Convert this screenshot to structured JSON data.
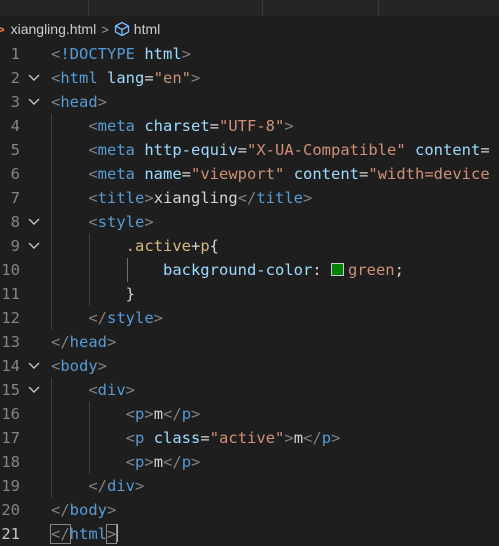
{
  "breadcrumb": {
    "file_name": "xiangling.html",
    "symbol_name": "html"
  },
  "lines": [
    {
      "n": "1",
      "fold": "",
      "tokens": [
        {
          "t": "punc",
          "v": "<"
        },
        {
          "t": "tag",
          "v": "!DOCTYPE"
        },
        {
          "t": "text",
          "v": " "
        },
        {
          "t": "attr",
          "v": "html"
        },
        {
          "t": "punc",
          "v": ">"
        }
      ]
    },
    {
      "n": "2",
      "fold": "⌵",
      "tokens": [
        {
          "t": "punc",
          "v": "<"
        },
        {
          "t": "tag",
          "v": "html"
        },
        {
          "t": "text",
          "v": " "
        },
        {
          "t": "attr",
          "v": "lang"
        },
        {
          "t": "text",
          "v": "="
        },
        {
          "t": "str",
          "v": "\"en\""
        },
        {
          "t": "punc",
          "v": ">"
        }
      ]
    },
    {
      "n": "3",
      "fold": "⌵",
      "tokens": [
        {
          "t": "punc",
          "v": "<"
        },
        {
          "t": "tag",
          "v": "head"
        },
        {
          "t": "punc",
          "v": ">"
        }
      ]
    },
    {
      "n": "4",
      "fold": "",
      "tokens": [
        {
          "t": "text",
          "v": "    "
        },
        {
          "t": "punc",
          "v": "<"
        },
        {
          "t": "tag",
          "v": "meta"
        },
        {
          "t": "text",
          "v": " "
        },
        {
          "t": "attr",
          "v": "charset"
        },
        {
          "t": "text",
          "v": "="
        },
        {
          "t": "str",
          "v": "\"UTF-8\""
        },
        {
          "t": "punc",
          "v": ">"
        }
      ]
    },
    {
      "n": "5",
      "fold": "",
      "tokens": [
        {
          "t": "text",
          "v": "    "
        },
        {
          "t": "punc",
          "v": "<"
        },
        {
          "t": "tag",
          "v": "meta"
        },
        {
          "t": "text",
          "v": " "
        },
        {
          "t": "attr",
          "v": "http-equiv"
        },
        {
          "t": "text",
          "v": "="
        },
        {
          "t": "str",
          "v": "\"X-UA-Compatible\""
        },
        {
          "t": "text",
          "v": " "
        },
        {
          "t": "attr",
          "v": "content"
        },
        {
          "t": "text",
          "v": "="
        }
      ]
    },
    {
      "n": "6",
      "fold": "",
      "tokens": [
        {
          "t": "text",
          "v": "    "
        },
        {
          "t": "punc",
          "v": "<"
        },
        {
          "t": "tag",
          "v": "meta"
        },
        {
          "t": "text",
          "v": " "
        },
        {
          "t": "attr",
          "v": "name"
        },
        {
          "t": "text",
          "v": "="
        },
        {
          "t": "str",
          "v": "\"viewport\""
        },
        {
          "t": "text",
          "v": " "
        },
        {
          "t": "attr",
          "v": "content"
        },
        {
          "t": "text",
          "v": "="
        },
        {
          "t": "str",
          "v": "\"width=device"
        }
      ]
    },
    {
      "n": "7",
      "fold": "",
      "tokens": [
        {
          "t": "text",
          "v": "    "
        },
        {
          "t": "punc",
          "v": "<"
        },
        {
          "t": "tag",
          "v": "title"
        },
        {
          "t": "punc",
          "v": ">"
        },
        {
          "t": "text",
          "v": "xiangling"
        },
        {
          "t": "punc",
          "v": "</"
        },
        {
          "t": "tag",
          "v": "title"
        },
        {
          "t": "punc",
          "v": ">"
        }
      ]
    },
    {
      "n": "8",
      "fold": "⌵",
      "tokens": [
        {
          "t": "text",
          "v": "    "
        },
        {
          "t": "punc",
          "v": "<"
        },
        {
          "t": "tag",
          "v": "style"
        },
        {
          "t": "punc",
          "v": ">"
        }
      ]
    },
    {
      "n": "9",
      "fold": "⌵",
      "tokens": [
        {
          "t": "text",
          "v": "        "
        },
        {
          "t": "sel",
          "v": ".active"
        },
        {
          "t": "text",
          "v": "+"
        },
        {
          "t": "sel",
          "v": "p"
        },
        {
          "t": "text",
          "v": "{"
        }
      ]
    },
    {
      "n": "10",
      "fold": "",
      "tokens": [
        {
          "t": "text",
          "v": "            "
        },
        {
          "t": "prop",
          "v": "background-color"
        },
        {
          "t": "text",
          "v": ": "
        },
        {
          "t": "swatch",
          "v": ""
        },
        {
          "t": "str",
          "v": "green"
        },
        {
          "t": "text",
          "v": ";"
        }
      ]
    },
    {
      "n": "11",
      "fold": "",
      "tokens": [
        {
          "t": "text",
          "v": "        }"
        }
      ]
    },
    {
      "n": "12",
      "fold": "",
      "tokens": [
        {
          "t": "text",
          "v": "    "
        },
        {
          "t": "punc",
          "v": "</"
        },
        {
          "t": "tag",
          "v": "style"
        },
        {
          "t": "punc",
          "v": ">"
        }
      ]
    },
    {
      "n": "13",
      "fold": "",
      "tokens": [
        {
          "t": "punc",
          "v": "</"
        },
        {
          "t": "tag",
          "v": "head"
        },
        {
          "t": "punc",
          "v": ">"
        }
      ]
    },
    {
      "n": "14",
      "fold": "⌵",
      "tokens": [
        {
          "t": "punc",
          "v": "<"
        },
        {
          "t": "tag",
          "v": "body"
        },
        {
          "t": "punc",
          "v": ">"
        }
      ]
    },
    {
      "n": "15",
      "fold": "⌵",
      "tokens": [
        {
          "t": "text",
          "v": "    "
        },
        {
          "t": "punc",
          "v": "<"
        },
        {
          "t": "tag",
          "v": "div"
        },
        {
          "t": "punc",
          "v": ">"
        }
      ]
    },
    {
      "n": "16",
      "fold": "",
      "tokens": [
        {
          "t": "text",
          "v": "        "
        },
        {
          "t": "punc",
          "v": "<"
        },
        {
          "t": "tag",
          "v": "p"
        },
        {
          "t": "punc",
          "v": ">"
        },
        {
          "t": "text",
          "v": "m"
        },
        {
          "t": "punc",
          "v": "</"
        },
        {
          "t": "tag",
          "v": "p"
        },
        {
          "t": "punc",
          "v": ">"
        }
      ]
    },
    {
      "n": "17",
      "fold": "",
      "tokens": [
        {
          "t": "text",
          "v": "        "
        },
        {
          "t": "punc",
          "v": "<"
        },
        {
          "t": "tag",
          "v": "p"
        },
        {
          "t": "text",
          "v": " "
        },
        {
          "t": "attr",
          "v": "class"
        },
        {
          "t": "text",
          "v": "="
        },
        {
          "t": "str",
          "v": "\"active\""
        },
        {
          "t": "punc",
          "v": ">"
        },
        {
          "t": "text",
          "v": "m"
        },
        {
          "t": "punc",
          "v": "</"
        },
        {
          "t": "tag",
          "v": "p"
        },
        {
          "t": "punc",
          "v": ">"
        }
      ]
    },
    {
      "n": "18",
      "fold": "",
      "tokens": [
        {
          "t": "text",
          "v": "        "
        },
        {
          "t": "punc",
          "v": "<"
        },
        {
          "t": "tag",
          "v": "p"
        },
        {
          "t": "punc",
          "v": ">"
        },
        {
          "t": "text",
          "v": "m"
        },
        {
          "t": "punc",
          "v": "</"
        },
        {
          "t": "tag",
          "v": "p"
        },
        {
          "t": "punc",
          "v": ">"
        }
      ]
    },
    {
      "n": "19",
      "fold": "",
      "tokens": [
        {
          "t": "text",
          "v": "    "
        },
        {
          "t": "punc",
          "v": "</"
        },
        {
          "t": "tag",
          "v": "div"
        },
        {
          "t": "punc",
          "v": ">"
        }
      ]
    },
    {
      "n": "20",
      "fold": "",
      "tokens": [
        {
          "t": "punc",
          "v": "</"
        },
        {
          "t": "tag",
          "v": "body"
        },
        {
          "t": "punc",
          "v": ">"
        }
      ]
    },
    {
      "n": "21",
      "fold": "",
      "active": true,
      "tokens": [
        {
          "t": "punc",
          "v": "</"
        },
        {
          "t": "tag",
          "v": "html"
        },
        {
          "t": "punc",
          "v": ">"
        },
        {
          "t": "cursor",
          "v": ""
        }
      ]
    }
  ],
  "colors": {
    "background": "#1e1e1e",
    "tag": "#569cd6",
    "attribute": "#9cdcfe",
    "string": "#ce9178",
    "selector": "#d7ba7d",
    "swatch_green": "#008000"
  }
}
